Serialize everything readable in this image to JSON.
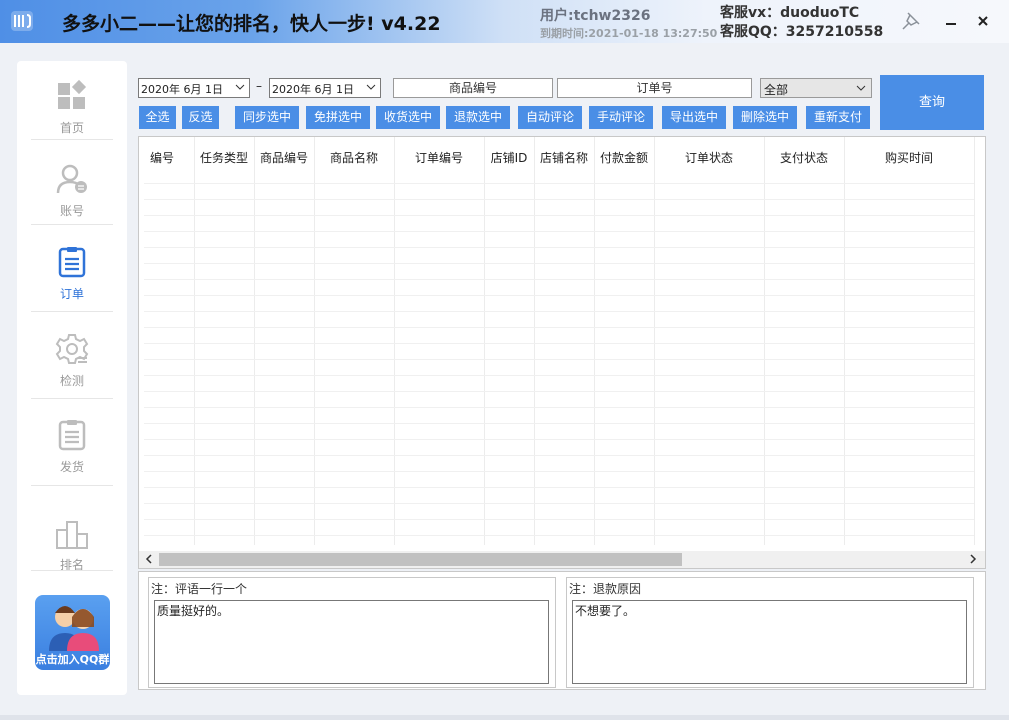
{
  "titlebar": {
    "title": "多多小二——让您的排名，快人一步! v4.22",
    "user": "用户:tchw2326",
    "expire": "到期时间:2021-01-18 13:27:50",
    "cs_vx": "客服vx：duoduoTC",
    "cs_qq": "客服QQ：3257210558"
  },
  "sidebar": {
    "items": [
      {
        "label": "首页",
        "icon": "home-grid-icon"
      },
      {
        "label": "账号",
        "icon": "user-account-icon"
      },
      {
        "label": "订单",
        "icon": "order-list-icon"
      },
      {
        "label": "检测",
        "icon": "gear-check-icon"
      },
      {
        "label": "发货",
        "icon": "shipping-list-icon"
      },
      {
        "label": "排名",
        "icon": "podium-icon"
      }
    ],
    "active": "订单",
    "qq_banner": "点击加入QQ群"
  },
  "filters": {
    "date_start": "2020年 6月 1日",
    "date_end": "2020年 6月 1日",
    "product_no_placeholder": "商品编号",
    "order_no_placeholder": "订单号",
    "status_select": "全部",
    "query": "查询"
  },
  "actions": [
    "全选",
    "反选",
    "同步选中",
    "免拼选中",
    "收货选中",
    "退款选中",
    "自动评论",
    "手动评论",
    "导出选中",
    "删除选中",
    "重新支付"
  ],
  "table": {
    "columns": [
      "编号",
      "任务类型",
      "商品编号",
      "商品名称",
      "订单编号",
      "店铺ID",
      "店铺名称",
      "付款金额",
      "订单状态",
      "支付状态",
      "购买时间"
    ],
    "rows": []
  },
  "notes": {
    "comment_label": "注：评语一行一个",
    "comment_text": "质量挺好的。",
    "refund_label": "注：退款原因",
    "refund_text": "不想要了。"
  },
  "colors": {
    "accent": "#4a8ee6",
    "active_nav": "#2f73d8"
  }
}
